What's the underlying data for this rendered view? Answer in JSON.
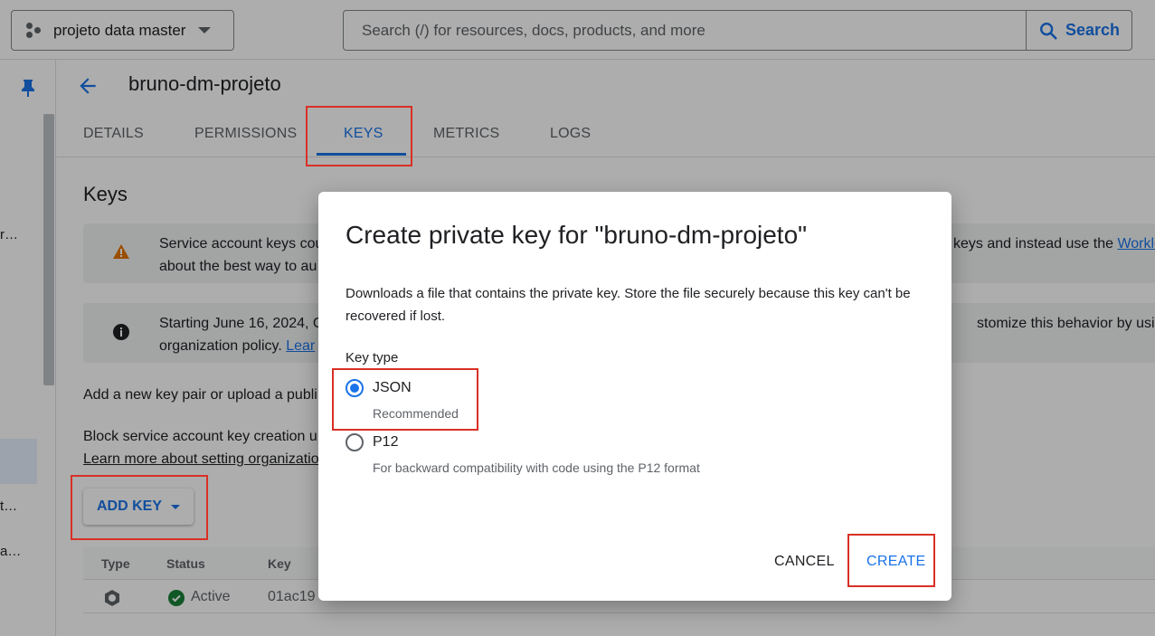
{
  "header": {
    "project_name": "projeto data master",
    "search_placeholder": "Search (/) for resources, docs, products, and more",
    "search_button": "Search"
  },
  "left_rail": {
    "items": [
      "r…",
      "t…",
      "a…"
    ]
  },
  "page": {
    "title": "bruno-dm-projeto",
    "tabs": [
      "DETAILS",
      "PERMISSIONS",
      "KEYS",
      "METRICS",
      "LOGS"
    ],
    "active_tab": "KEYS",
    "section_title": "Keys",
    "warning_banner": {
      "line1_start": "Service account keys cou",
      "line1_end": "keys and instead use the ",
      "line1_link": "Worklo",
      "line2": "about the best way to au"
    },
    "info_banner": {
      "line1_start": "Starting June 16, 2024, C",
      "line1_end": "stomize this behavior by using th",
      "line2_text": "organization policy. ",
      "line2_link": "Lear"
    },
    "add_key_text": "Add a new key pair or upload a publi",
    "block_text": "Block service account key creation u",
    "learn_more_link": "Learn more about setting organizatio",
    "add_key_button": "ADD KEY",
    "table": {
      "headers": [
        "Type",
        "Status",
        "Key"
      ],
      "row": {
        "status": "Active",
        "key": "01ac19"
      }
    }
  },
  "dialog": {
    "title": "Create private key for \"bruno-dm-projeto\"",
    "description": "Downloads a file that contains the private key. Store the file securely because this key can't be recovered if lost.",
    "key_type_label": "Key type",
    "options": [
      {
        "label": "JSON",
        "hint": "Recommended",
        "checked": true
      },
      {
        "label": "P12",
        "hint": "For backward compatibility with code using the P12 format",
        "checked": false
      }
    ],
    "cancel": "CANCEL",
    "create": "CREATE"
  },
  "colors": {
    "accent": "#1a73e8",
    "highlight_box": "#d93025",
    "warning": "#e37400",
    "success": "#188038"
  }
}
